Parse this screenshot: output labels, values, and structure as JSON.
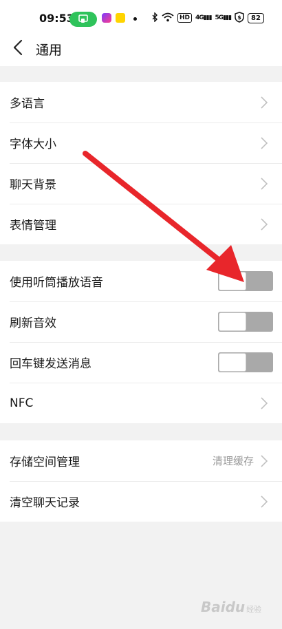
{
  "status_bar": {
    "time": "09:53",
    "signal_1": "4G",
    "signal_2": "5G",
    "battery": "82",
    "hd_badge": "HD"
  },
  "header": {
    "title": "通用",
    "back_icon": "chevron-left-icon"
  },
  "group1": {
    "items": [
      {
        "label": "多语言",
        "type": "link"
      },
      {
        "label": "字体大小",
        "type": "link"
      },
      {
        "label": "聊天背景",
        "type": "link"
      },
      {
        "label": "表情管理",
        "type": "link"
      }
    ]
  },
  "group2": {
    "items": [
      {
        "label": "使用听筒播放语音",
        "type": "toggle",
        "on": false
      },
      {
        "label": "刷新音效",
        "type": "toggle",
        "on": false
      },
      {
        "label": "回车键发送消息",
        "type": "toggle",
        "on": false
      },
      {
        "label": "NFC",
        "type": "link"
      }
    ]
  },
  "group3": {
    "items": [
      {
        "label": "存储空间管理",
        "type": "link",
        "hint": "清理缓存"
      },
      {
        "label": "清空聊天记录",
        "type": "link"
      }
    ]
  },
  "annotation": {
    "color": "#e8262b"
  },
  "watermark": {
    "brand": "Baidu",
    "suffix": "经验"
  },
  "colors": {
    "toggle_off": "#a9a9a9",
    "cast_pill": "#2fc35b"
  }
}
